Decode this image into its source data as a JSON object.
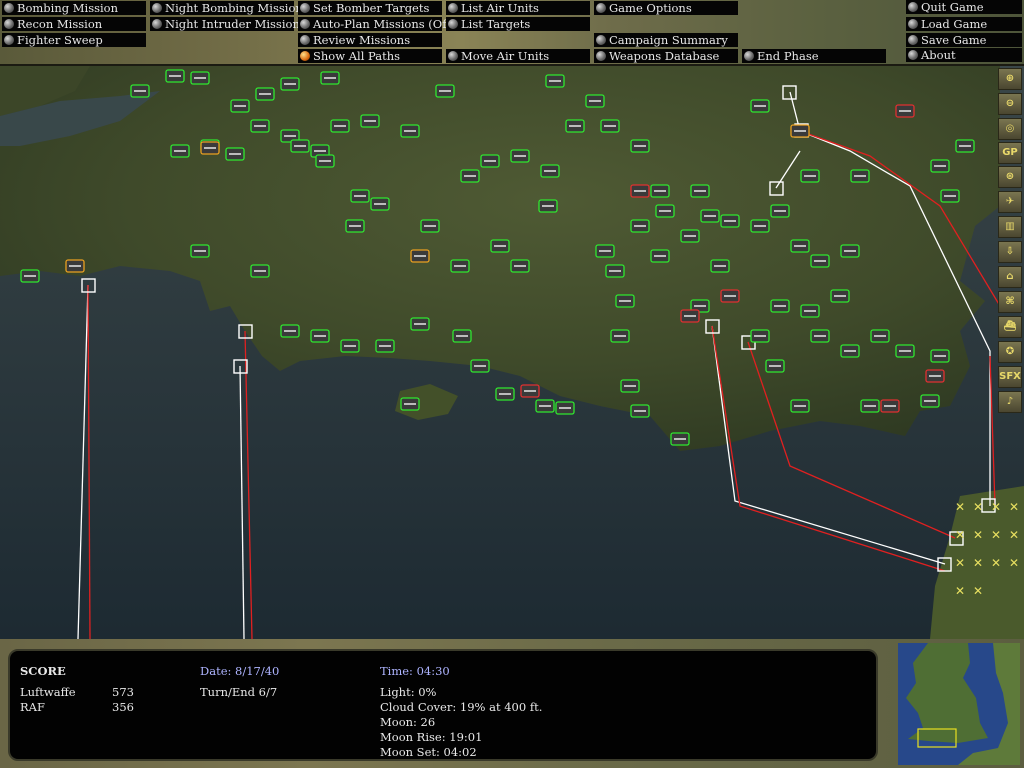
{
  "menu": {
    "bombing": "Bombing Mission",
    "recon": "Recon Mission",
    "fighter": "Fighter Sweep",
    "night_bombing": "Night Bombing Mission",
    "night_intruder": "Night Intruder Mission",
    "set_bomber": "Set Bomber Targets",
    "auto_plan": "Auto-Plan Missions (Off)",
    "review": "Review Missions",
    "show_paths": "Show All Paths",
    "list_air": "List Air Units",
    "list_targets": "List Targets",
    "move_air": "Move Air Units",
    "game_options": "Game Options",
    "campaign": "Campaign Summary",
    "weapons": "Weapons Database",
    "end_phase": "End Phase",
    "quit": "Quit Game",
    "load": "Load Game",
    "save": "Save Game",
    "about": "About"
  },
  "toolbar": {
    "gp": "GP",
    "sfx": "SFX"
  },
  "score": {
    "title": "SCORE",
    "luftwaffe_label": "Luftwaffe",
    "luftwaffe_value": "573",
    "raf_label": "RAF",
    "raf_value": "356"
  },
  "status": {
    "date": "Date: 8/17/40",
    "turn": "Turn/End 6/7",
    "time": "Time: 04:30",
    "light": "Light: 0%",
    "cloud": "Cloud Cover: 19% at 400 ft.",
    "moon": "Moon: 26",
    "moonrise": "Moon Rise: 19:01",
    "moonset": "Moon Set: 04:02"
  },
  "colors": {
    "raf_marker": "#2fe82f",
    "enemy_marker": "#e03030",
    "path_white": "#ffffff",
    "path_red": "#e02020",
    "highlight": "#e9a020"
  }
}
